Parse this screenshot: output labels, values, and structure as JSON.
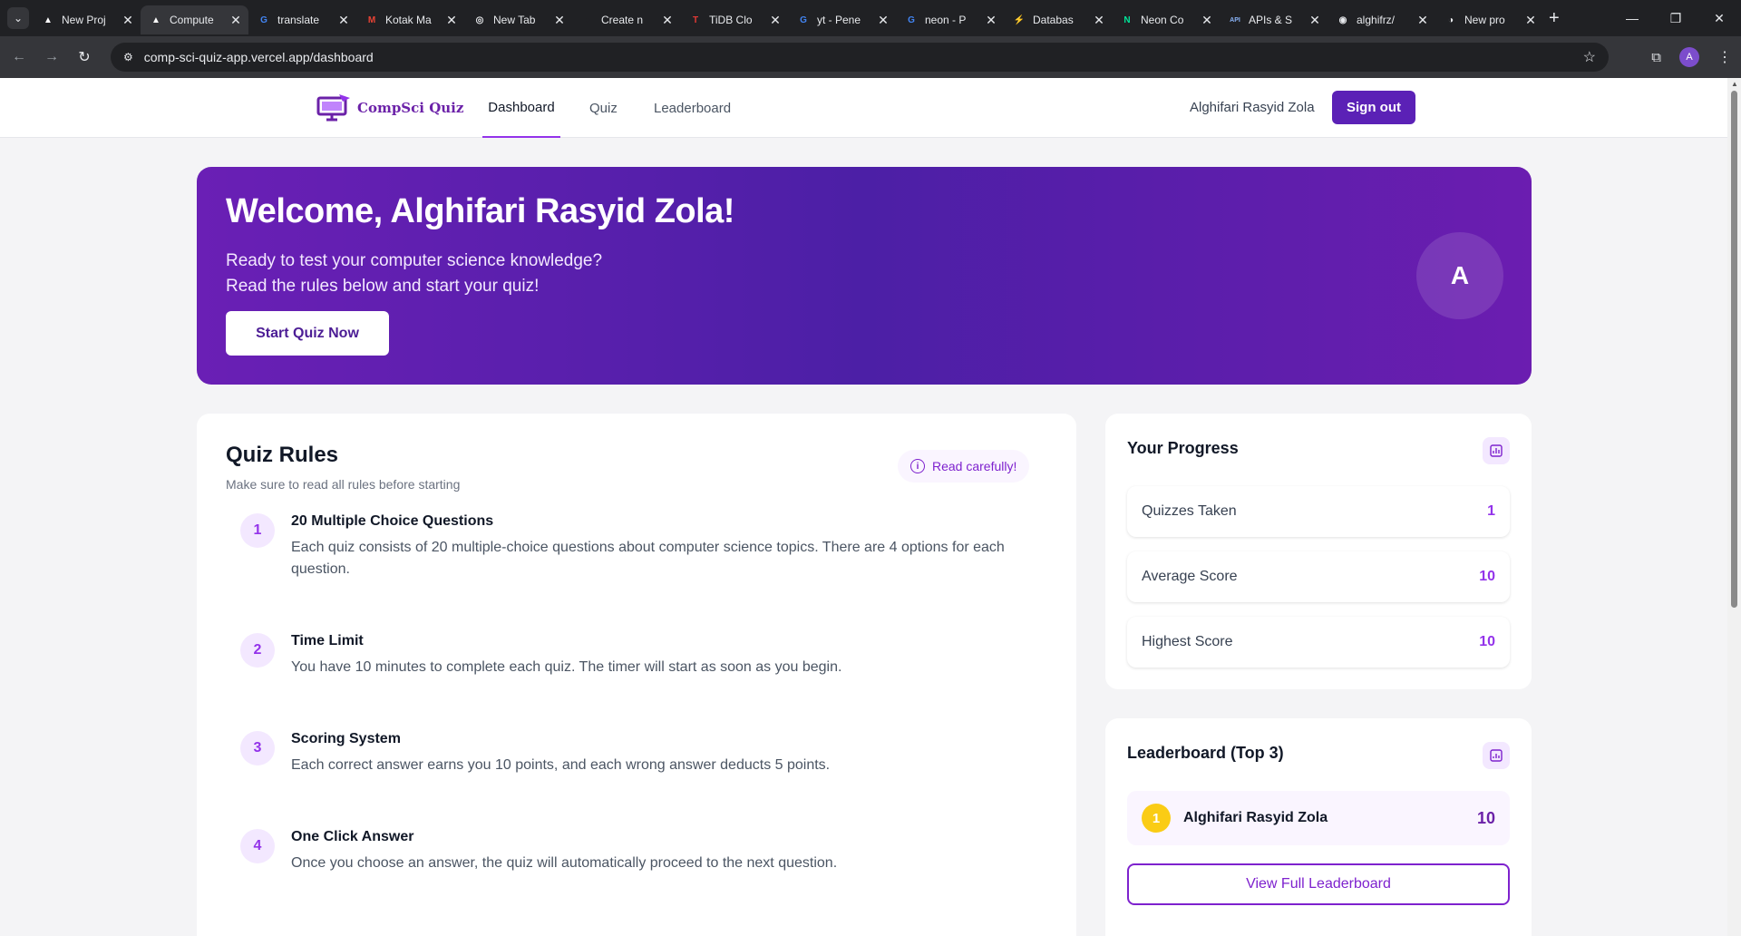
{
  "browser": {
    "tabs": [
      {
        "title": "New Proj",
        "fav": "▲",
        "favColor": "#ffffff",
        "active": false
      },
      {
        "title": "Compute",
        "fav": "▲",
        "favColor": "#ffffff",
        "active": true
      },
      {
        "title": "translate",
        "fav": "G",
        "favColor": "#4285f4",
        "active": false
      },
      {
        "title": "Kotak Ma",
        "fav": "M",
        "favColor": "#ea4335",
        "active": false
      },
      {
        "title": "New Tab",
        "fav": "◎",
        "favColor": "#e8eaed",
        "active": false
      },
      {
        "title": "Create n",
        "fav": "●",
        "favColor": "#202124",
        "active": false
      },
      {
        "title": "TiDB Clo",
        "fav": "T",
        "favColor": "#e53935",
        "active": false
      },
      {
        "title": "yt - Pene",
        "fav": "G",
        "favColor": "#4285f4",
        "active": false
      },
      {
        "title": "neon - P",
        "fav": "G",
        "favColor": "#4285f4",
        "active": false
      },
      {
        "title": "Databas",
        "fav": "⚡",
        "favColor": "#3ecf8e",
        "active": false
      },
      {
        "title": "Neon Co",
        "fav": "N",
        "favColor": "#00e599",
        "active": false
      },
      {
        "title": "APIs & S",
        "fav": "API",
        "favColor": "#8ab4f8",
        "active": false
      },
      {
        "title": "alghifrz/",
        "fav": "◉",
        "favColor": "#e8eaed",
        "active": false
      },
      {
        "title": "New pro",
        "fav": "◑",
        "favColor": "#e8eaed",
        "active": false
      }
    ],
    "url": "comp-sci-quiz-app.vercel.app/dashboard",
    "profile_initial": "A"
  },
  "header": {
    "logo_text": "CompSci Quiz",
    "nav": [
      {
        "label": "Dashboard",
        "active": true
      },
      {
        "label": "Quiz",
        "active": false
      },
      {
        "label": "Leaderboard",
        "active": false
      }
    ],
    "user_name": "Alghifari Rasyid Zola",
    "signout_label": "Sign out"
  },
  "hero": {
    "title": "Welcome, Alghifari Rasyid Zola!",
    "subtitle_line1": "Ready to test your computer science knowledge?",
    "subtitle_line2": "Read the rules below and start your quiz!",
    "cta_label": "Start Quiz Now",
    "avatar_initial": "A"
  },
  "rules": {
    "title": "Quiz Rules",
    "subtitle": "Make sure to read all rules before starting",
    "badge": "Read carefully!",
    "items": [
      {
        "num": "1",
        "title": "20 Multiple Choice Questions",
        "desc": "Each quiz consists of 20 multiple-choice questions about computer science topics. There are 4 options for each question."
      },
      {
        "num": "2",
        "title": "Time Limit",
        "desc": "You have 10 minutes to complete each quiz. The timer will start as soon as you begin."
      },
      {
        "num": "3",
        "title": "Scoring System",
        "desc": "Each correct answer earns you 10 points, and each wrong answer deducts 5 points."
      },
      {
        "num": "4",
        "title": "One Click Answer",
        "desc": "Once you choose an answer, the quiz will automatically proceed to the next question."
      }
    ]
  },
  "progress": {
    "title": "Your Progress",
    "stats": [
      {
        "label": "Quizzes Taken",
        "value": "1"
      },
      {
        "label": "Average Score",
        "value": "10"
      },
      {
        "label": "Highest Score",
        "value": "10"
      }
    ]
  },
  "leaderboard": {
    "title": "Leaderboard (Top 3)",
    "entries": [
      {
        "rank": "1",
        "name": "Alghifari Rasyid Zola",
        "score": "10"
      }
    ],
    "button_label": "View Full Leaderboard"
  },
  "colors": {
    "brand": "#6b21a8",
    "accent": "#9333ea",
    "gold": "#facc15"
  }
}
